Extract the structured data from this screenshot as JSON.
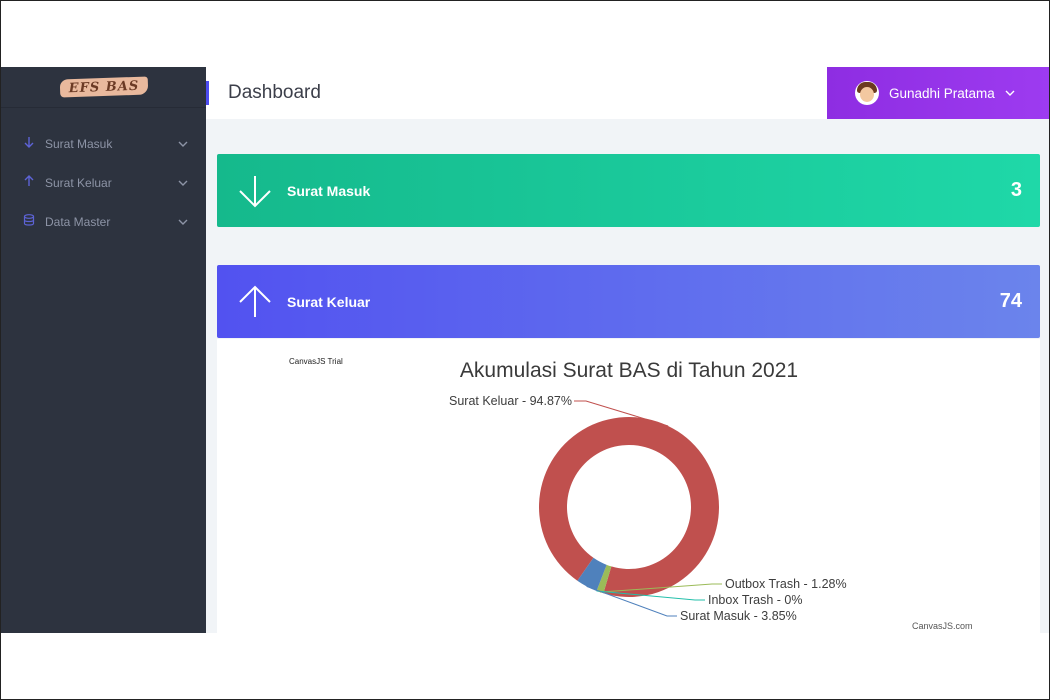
{
  "app": {
    "logo_text": "EFS BAS",
    "page_title": "Dashboard",
    "accent_color": "#4c4cf0"
  },
  "sidebar": {
    "items": [
      {
        "label": "Surat Masuk",
        "icon": "arrow-down-icon"
      },
      {
        "label": "Surat Keluar",
        "icon": "arrow-up-icon"
      },
      {
        "label": "Data Master",
        "icon": "database-icon"
      }
    ]
  },
  "user": {
    "name": "Gunadhi Pratama"
  },
  "cards": [
    {
      "label": "Surat Masuk",
      "count": "3",
      "icon": "arrow-down-icon",
      "color": "#15b98c"
    },
    {
      "label": "Surat Keluar",
      "count": "74",
      "icon": "arrow-up-icon",
      "color": "#5252f0"
    }
  ],
  "chart_credit": {
    "trial": "CanvasJS Trial",
    "site": "CanvasJS.com"
  },
  "chart_data": {
    "type": "pie",
    "title": "Akumulasi Surat BAS di Tahun 2021",
    "style": "doughnut",
    "slices": [
      {
        "label": "Surat Keluar",
        "value": 94.87,
        "display": "Surat Keluar - 94.87%",
        "color": "#c0504e"
      },
      {
        "label": "Outbox Trash",
        "value": 1.28,
        "display": "Outbox Trash - 1.28%",
        "color": "#9bbb58"
      },
      {
        "label": "Inbox Trash",
        "value": 0,
        "display": "Inbox Trash - 0%",
        "color": "#23bfaa"
      },
      {
        "label": "Surat Masuk",
        "value": 3.85,
        "display": "Surat Masuk - 3.85%",
        "color": "#4f81bc"
      }
    ]
  }
}
